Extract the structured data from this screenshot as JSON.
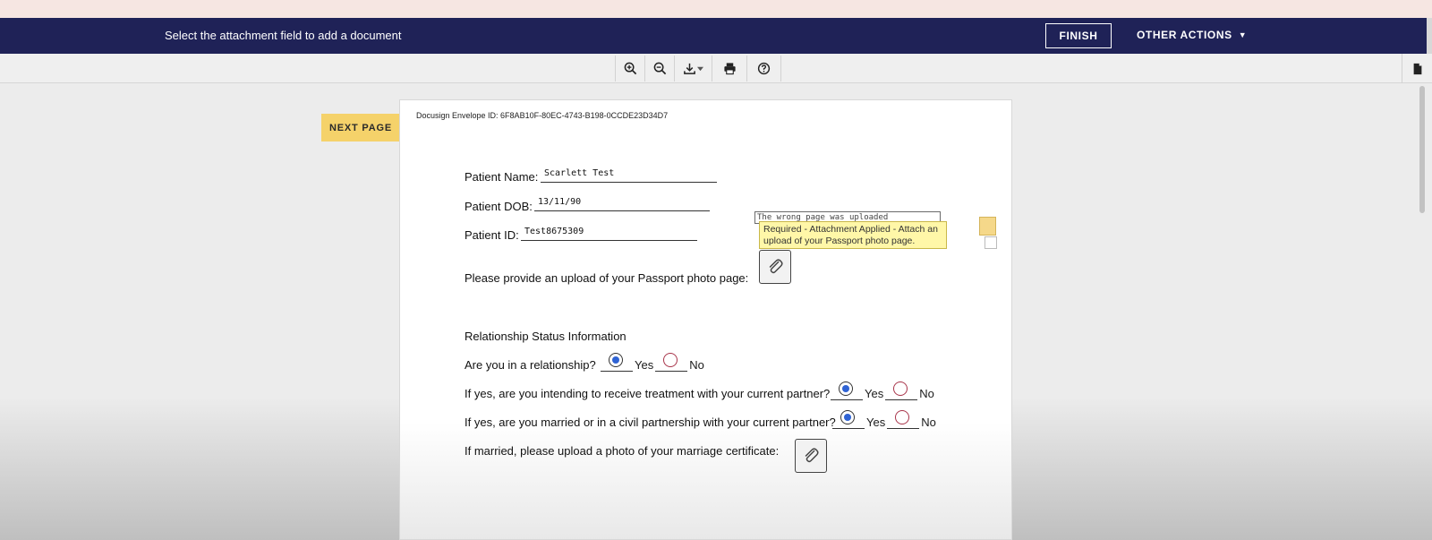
{
  "header": {
    "message": "Select the attachment field to add a document",
    "finish_label": "FINISH",
    "other_actions_label": "OTHER ACTIONS",
    "other_actions_caret": "▼"
  },
  "toolbar": {
    "items": [
      "zoom-in-icon",
      "zoom-out-icon",
      "download-icon",
      "print-icon",
      "help-icon"
    ]
  },
  "next_page_label": "NEXT PAGE",
  "document": {
    "envelope_id": "Docusign Envelope ID: 6F8AB10F-80EC-4743-B198-0CCDE23D34D7",
    "patient_name_label": "Patient Name:",
    "patient_name_value": "Scarlett Test",
    "patient_dob_label": "Patient DOB:",
    "patient_dob_value": "13/11/90",
    "patient_id_label": "Patient ID:",
    "patient_id_value": "Test8675309",
    "passport_prompt": "Please provide an upload of your Passport photo page:",
    "comment_text": "The wrong page was uploaded",
    "tooltip_text": "Required - Attachment Applied - Attach an upload of your Passport photo page.",
    "relationship_heading": "Relationship Status Information",
    "questions": [
      {
        "text": "Are you in a relationship?",
        "yes": "Yes",
        "no": "No",
        "selected": "yes"
      },
      {
        "text": "If yes, are you intending to receive treatment with your current partner?",
        "yes": "Yes",
        "no": "No",
        "selected": "yes"
      },
      {
        "text": "If yes, are you married or in a civil partnership with your current partner?",
        "yes": "Yes",
        "no": "No",
        "selected": "yes"
      }
    ],
    "marriage_prompt": "If married, please upload a photo of your marriage certificate:"
  },
  "colors": {
    "header_bg": "#1f2257",
    "next_page_bg": "#f5d26a",
    "tooltip_bg": "#fff7a8",
    "radio_selected": "#2f63d4"
  }
}
